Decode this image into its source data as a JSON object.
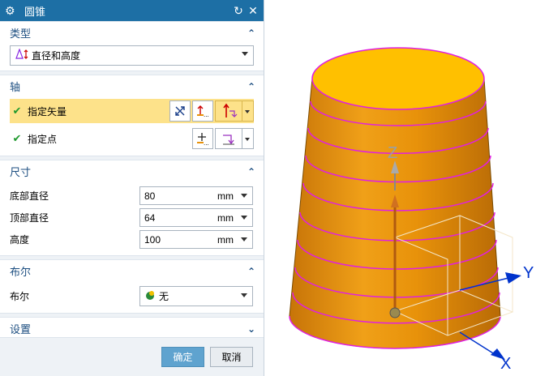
{
  "dialog": {
    "title": "圆锥",
    "title_icon": "gear-icon",
    "reset_icon": "reset-icon",
    "close_icon": "close-icon"
  },
  "groups": {
    "type": {
      "header": "类型",
      "selected": "直径和高度"
    },
    "axis": {
      "header": "轴",
      "specify_vector": "指定矢量",
      "specify_point": "指定点"
    },
    "dimensions": {
      "header": "尺寸",
      "fields": [
        {
          "label": "底部直径",
          "value": "80",
          "unit": "mm"
        },
        {
          "label": "顶部直径",
          "value": "64",
          "unit": "mm"
        },
        {
          "label": "高度",
          "value": "100",
          "unit": "mm"
        }
      ]
    },
    "boolean": {
      "header": "布尔",
      "label": "布尔",
      "value": "无"
    },
    "settings": {
      "header": "设置"
    }
  },
  "footer": {
    "ok": "确定",
    "cancel": "取消"
  },
  "viewport": {
    "axis_z": "Z",
    "axis_y": "Y",
    "axis_x": "X"
  },
  "colors": {
    "titlebar": "#1d6fa5",
    "highlight": "#fde28a",
    "cone_side": "#e8920a",
    "cone_top": "#ffc000",
    "edges": "#e020e0",
    "axis_arrow": "#0033cc"
  }
}
